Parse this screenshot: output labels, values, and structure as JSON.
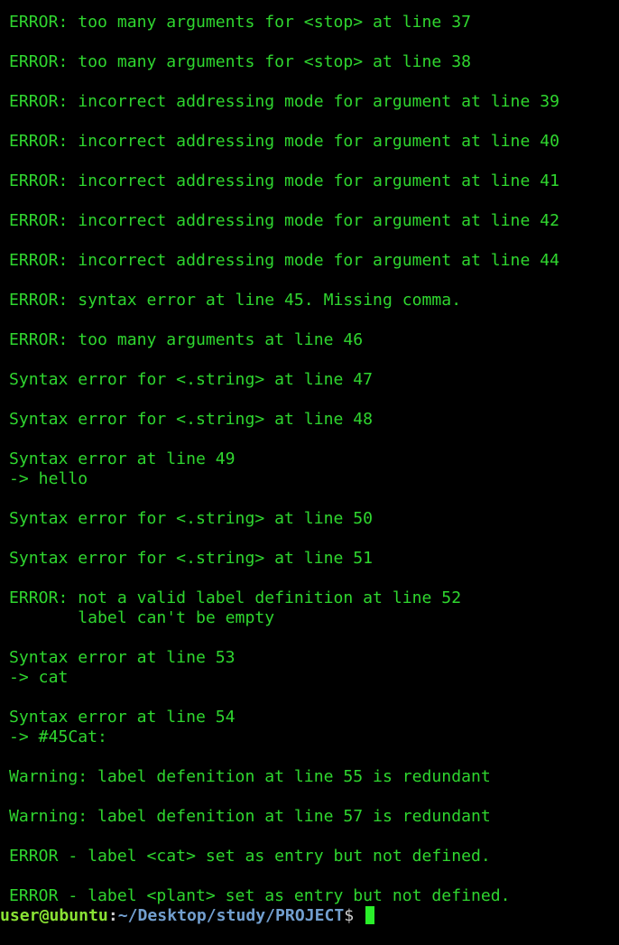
{
  "colors": {
    "background": "#000000",
    "output_text": "#2fd62f",
    "prompt_user": "#8ae234",
    "prompt_path": "#729fcf",
    "cursor": "#2aef2a"
  },
  "lines": [
    "ERROR: too many arguments for <stop> at line 37",
    "",
    "ERROR: too many arguments for <stop> at line 38",
    "",
    "ERROR: incorrect addressing mode for argument at line 39",
    "",
    "ERROR: incorrect addressing mode for argument at line 40",
    "",
    "ERROR: incorrect addressing mode for argument at line 41",
    "",
    "ERROR: incorrect addressing mode for argument at line 42",
    "",
    "ERROR: incorrect addressing mode for argument at line 44",
    "",
    "ERROR: syntax error at line 45. Missing comma.",
    "",
    "ERROR: too many arguments at line 46",
    "",
    "Syntax error for <.string> at line 47",
    "",
    "Syntax error for <.string> at line 48",
    "",
    "Syntax error at line 49",
    "-> hello",
    "",
    "Syntax error for <.string> at line 50",
    "",
    "Syntax error for <.string> at line 51",
    "",
    "ERROR: not a valid label definition at line 52",
    "       label can't be empty",
    "",
    "Syntax error at line 53",
    "-> cat",
    "",
    "Syntax error at line 54",
    "-> #45Cat:",
    "",
    "Warning: label defenition at line 55 is redundant",
    "",
    "Warning: label defenition at line 57 is redundant",
    "",
    "ERROR - label <cat> set as entry but not defined.",
    "",
    "ERROR - label <plant> set as entry but not defined."
  ],
  "prompt": {
    "user_host": "user@ubuntu",
    "separator": ":",
    "path": "~/Desktop/study/PROJECT",
    "symbol": "$ "
  }
}
